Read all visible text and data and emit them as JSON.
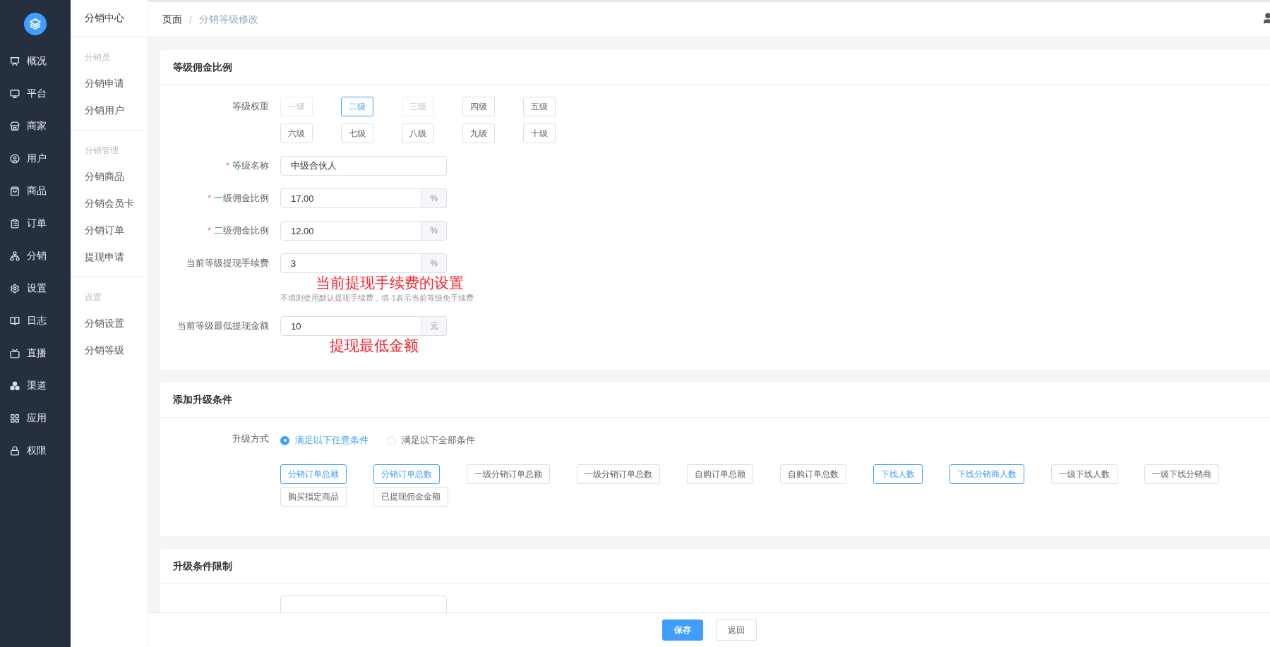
{
  "sidebar": {
    "items": [
      {
        "label": "概况"
      },
      {
        "label": "平台"
      },
      {
        "label": "商家"
      },
      {
        "label": "用户"
      },
      {
        "label": "商品"
      },
      {
        "label": "订单"
      },
      {
        "label": "分销"
      },
      {
        "label": "设置"
      },
      {
        "label": "日志"
      },
      {
        "label": "直播"
      },
      {
        "label": "渠道"
      },
      {
        "label": "应用"
      },
      {
        "label": "权限"
      }
    ]
  },
  "submenu": {
    "title": "分销中心",
    "groups": [
      {
        "heading": "分销员",
        "items": [
          "分销申请",
          "分销用户"
        ]
      },
      {
        "heading": "分销管理",
        "items": [
          "分销商品",
          "分销会员卡",
          "分销订单",
          "提现申请"
        ]
      },
      {
        "heading": "设置",
        "items": [
          "分销设置",
          "分销等级"
        ]
      }
    ]
  },
  "breadcrumb": {
    "items": [
      "页面",
      "分销等级修改"
    ],
    "separator": "/"
  },
  "level_card": {
    "title": "等级佣金比例",
    "weight_label": "等级权重",
    "levels": [
      {
        "label": "一级",
        "selected": false,
        "disabled": true
      },
      {
        "label": "二级",
        "selected": true,
        "disabled": false
      },
      {
        "label": "三级",
        "selected": false,
        "disabled": true
      },
      {
        "label": "四级",
        "selected": false,
        "disabled": false
      },
      {
        "label": "五级",
        "selected": false,
        "disabled": false
      },
      {
        "label": "六级",
        "selected": false,
        "disabled": false
      },
      {
        "label": "七级",
        "selected": false,
        "disabled": false
      },
      {
        "label": "八级",
        "selected": false,
        "disabled": false
      },
      {
        "label": "九级",
        "selected": false,
        "disabled": false
      },
      {
        "label": "十级",
        "selected": false,
        "disabled": false
      }
    ],
    "fields": [
      {
        "label": "等级名称",
        "required_mark": "*",
        "value": "中级合伙人"
      },
      {
        "label": "一级佣金比例",
        "required_mark": "*",
        "value": "17.00",
        "suffix": "%"
      },
      {
        "label": "二级佣金比例",
        "required_mark": "*",
        "value": "12.00",
        "suffix": "%"
      },
      {
        "label": "当前等级提现手续费",
        "value": "3",
        "suffix": "%",
        "annotation": "当前提现手续费的设置",
        "hint": "不填则使用默认提现手续费，填-1表示当前等级免手续费"
      },
      {
        "label": "当前等级最低提现金额",
        "value": "10",
        "suffix": "元",
        "annotation": "提现最低金额"
      }
    ]
  },
  "condition_card": {
    "title": "添加升级条件",
    "mode_label": "升级方式",
    "modes": [
      {
        "label": "满足以下任意条件",
        "selected": true
      },
      {
        "label": "满足以下全部条件",
        "selected": false
      }
    ],
    "conditions": [
      {
        "label": "分销订单总额",
        "selected": true
      },
      {
        "label": "分销订单总数",
        "selected": true
      },
      {
        "label": "一级分销订单总额",
        "selected": false
      },
      {
        "label": "一级分销订单总数",
        "selected": false
      },
      {
        "label": "自购订单总额",
        "selected": false
      },
      {
        "label": "自购订单总数",
        "selected": false
      },
      {
        "label": "下线人数",
        "selected": true
      },
      {
        "label": "下线分销商人数",
        "selected": true
      },
      {
        "label": "一级下线人数",
        "selected": false
      },
      {
        "label": "一级下线分销商",
        "selected": false
      },
      {
        "label": "购买指定商品",
        "selected": false
      },
      {
        "label": "已提现佣金金额",
        "selected": false
      }
    ]
  },
  "limit_card": {
    "title": "升级条件限制"
  },
  "footer": {
    "buttons": [
      {
        "label": "保存",
        "kind": "primary"
      },
      {
        "label": "返回",
        "kind": "default"
      }
    ]
  }
}
